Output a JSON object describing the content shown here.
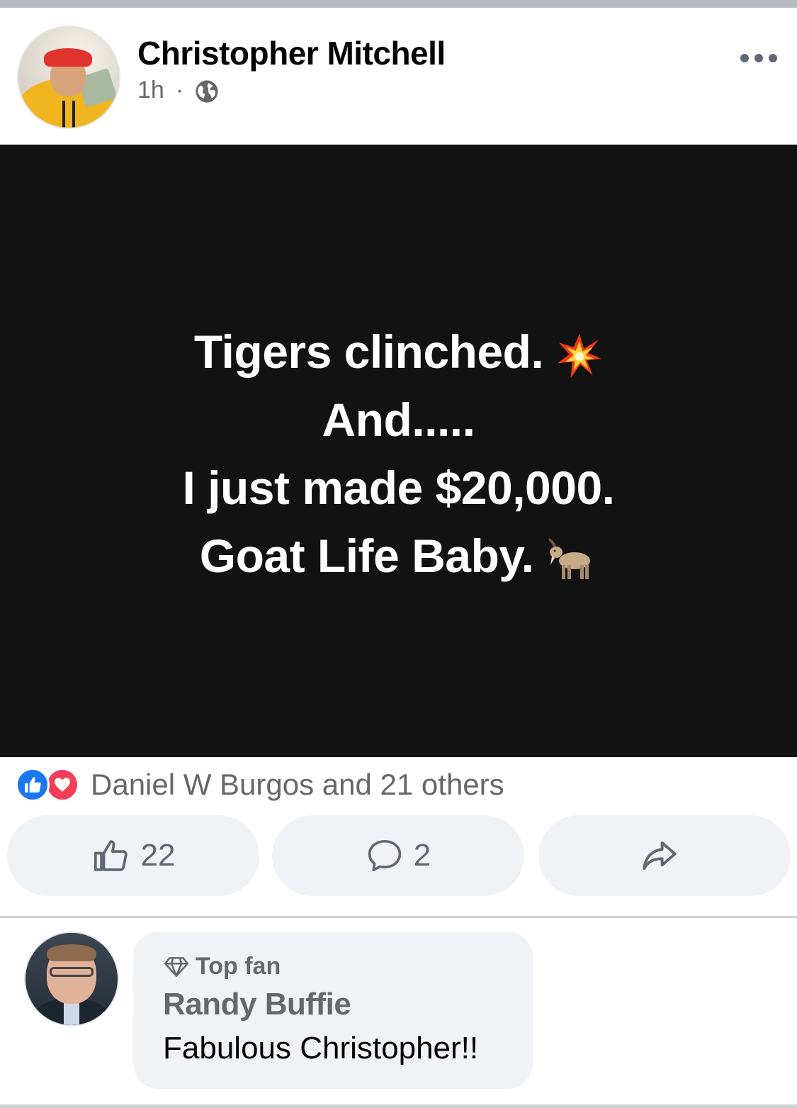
{
  "post": {
    "author": "Christopher Mitchell",
    "time": "1h",
    "separator": "·",
    "audience_icon": "globe-icon",
    "lines": [
      "Tigers clinched.",
      "And.....",
      "I just made $20,000.",
      "Goat Life Baby."
    ],
    "line_emojis": [
      "collision-icon",
      "",
      "",
      "goat-icon"
    ]
  },
  "reactions": {
    "text": "Daniel W Burgos and 21 others",
    "icons": [
      "like-icon",
      "love-icon"
    ],
    "colors": {
      "like": "#1877f2",
      "love": "#f33e58"
    }
  },
  "actions": {
    "like_count": "22",
    "comment_count": "2"
  },
  "comment": {
    "badge": "Top fan",
    "badge_icon": "diamond-icon",
    "author": "Randy Buffie",
    "text": "Fabulous Christopher!!"
  }
}
